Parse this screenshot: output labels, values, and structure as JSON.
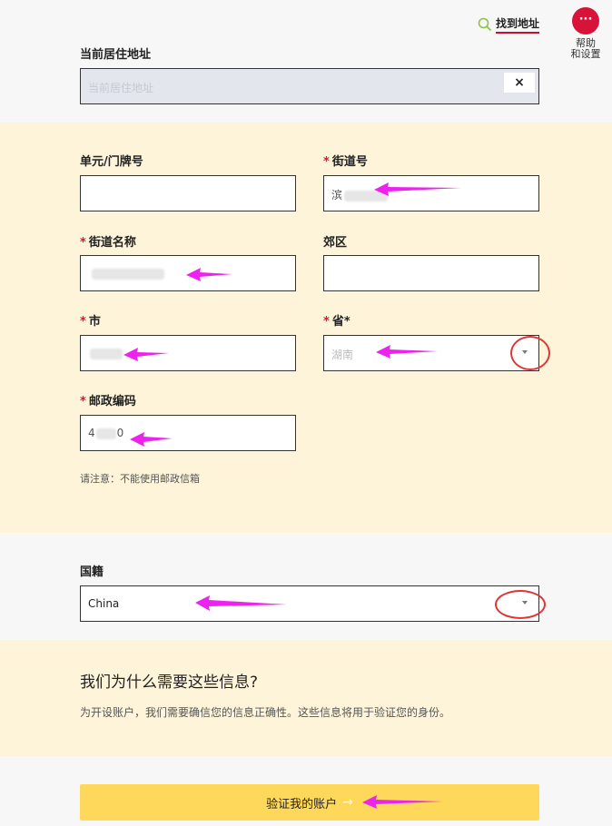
{
  "header": {
    "find_address_label": "找到地址",
    "help_icon_text": "···",
    "help_line1": "帮助",
    "help_line2": "和设置"
  },
  "current_address": {
    "label": "当前居住地址",
    "placeholder": "当前居住地址",
    "clear_label": "×"
  },
  "address_form": {
    "unit_label": "单元/门牌号",
    "unit_value": "",
    "street_number_label": "街道号",
    "street_number_value": "滨",
    "street_name_label": "街道名称",
    "street_name_value": "",
    "suburb_label": "郊区",
    "suburb_value": "",
    "city_label": "市",
    "city_value": "",
    "province_label": "省*",
    "province_value": "湖南",
    "postcode_label": "邮政编码",
    "postcode_value_start": "4",
    "postcode_value_end": "0",
    "required_mark": "*",
    "note": "请注意：不能使用邮政信箱"
  },
  "nationality": {
    "label": "国籍",
    "value": "China"
  },
  "why_section": {
    "title": "我们为什么需要这些信息?",
    "text": "为开设账户，我们需要确信您的信息正确性。这些信息将用于验证您的身份。"
  },
  "submit": {
    "label": "验证我的账户",
    "arrow": "→"
  },
  "colors": {
    "accent_red": "#d7133a",
    "band_yellow": "#fdf4d9",
    "button_yellow": "#fdd85a",
    "annotation_magenta": "#ee22ee",
    "annotation_circle": "#e03535"
  }
}
